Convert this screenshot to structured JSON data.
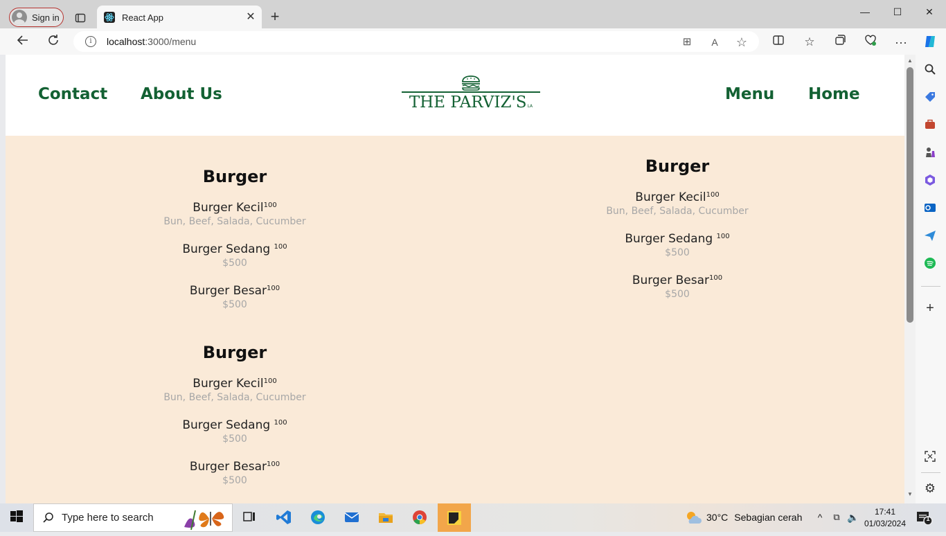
{
  "browser": {
    "signin_label": "Sign in",
    "tab_title": "React App",
    "url_host": "localhost",
    "url_path": ":3000/menu"
  },
  "site": {
    "nav_left": [
      "Contact",
      "About Us"
    ],
    "nav_right": [
      "Menu",
      "Home"
    ],
    "logo_text": "THE PARVIZ'S",
    "logo_suffix": "LA"
  },
  "menu_sections": [
    {
      "title": "Burger",
      "items": [
        {
          "name": "Burger Kecil",
          "sup": "100",
          "desc": "Bun, Beef, Salada, Cucumber"
        },
        {
          "name": "Burger Sedang ",
          "sup": "100",
          "desc": "$500"
        },
        {
          "name": "Burger Besar",
          "sup": "100",
          "desc": "$500"
        }
      ]
    },
    {
      "title": "Burger",
      "items": [
        {
          "name": "Burger Kecil",
          "sup": "100",
          "desc": "Bun, Beef, Salada, Cucumber"
        },
        {
          "name": "Burger Sedang ",
          "sup": "100",
          "desc": "$500"
        },
        {
          "name": "Burger Besar",
          "sup": "100",
          "desc": "$500"
        }
      ]
    },
    {
      "title": "Burger",
      "items": [
        {
          "name": "Burger Kecil",
          "sup": "100",
          "desc": "Bun, Beef, Salada, Cucumber"
        },
        {
          "name": "Burger Sedang ",
          "sup": "100",
          "desc": "$500"
        },
        {
          "name": "Burger Besar",
          "sup": "100",
          "desc": "$500"
        }
      ]
    }
  ],
  "taskbar": {
    "search_placeholder": "Type here to search",
    "weather_temp": "30°C",
    "weather_desc": "Sebagian cerah",
    "time": "17:41",
    "date": "01/03/2024",
    "notification_count": "1"
  },
  "colors": {
    "brand_green": "#136133",
    "menu_background": "#faead8"
  }
}
